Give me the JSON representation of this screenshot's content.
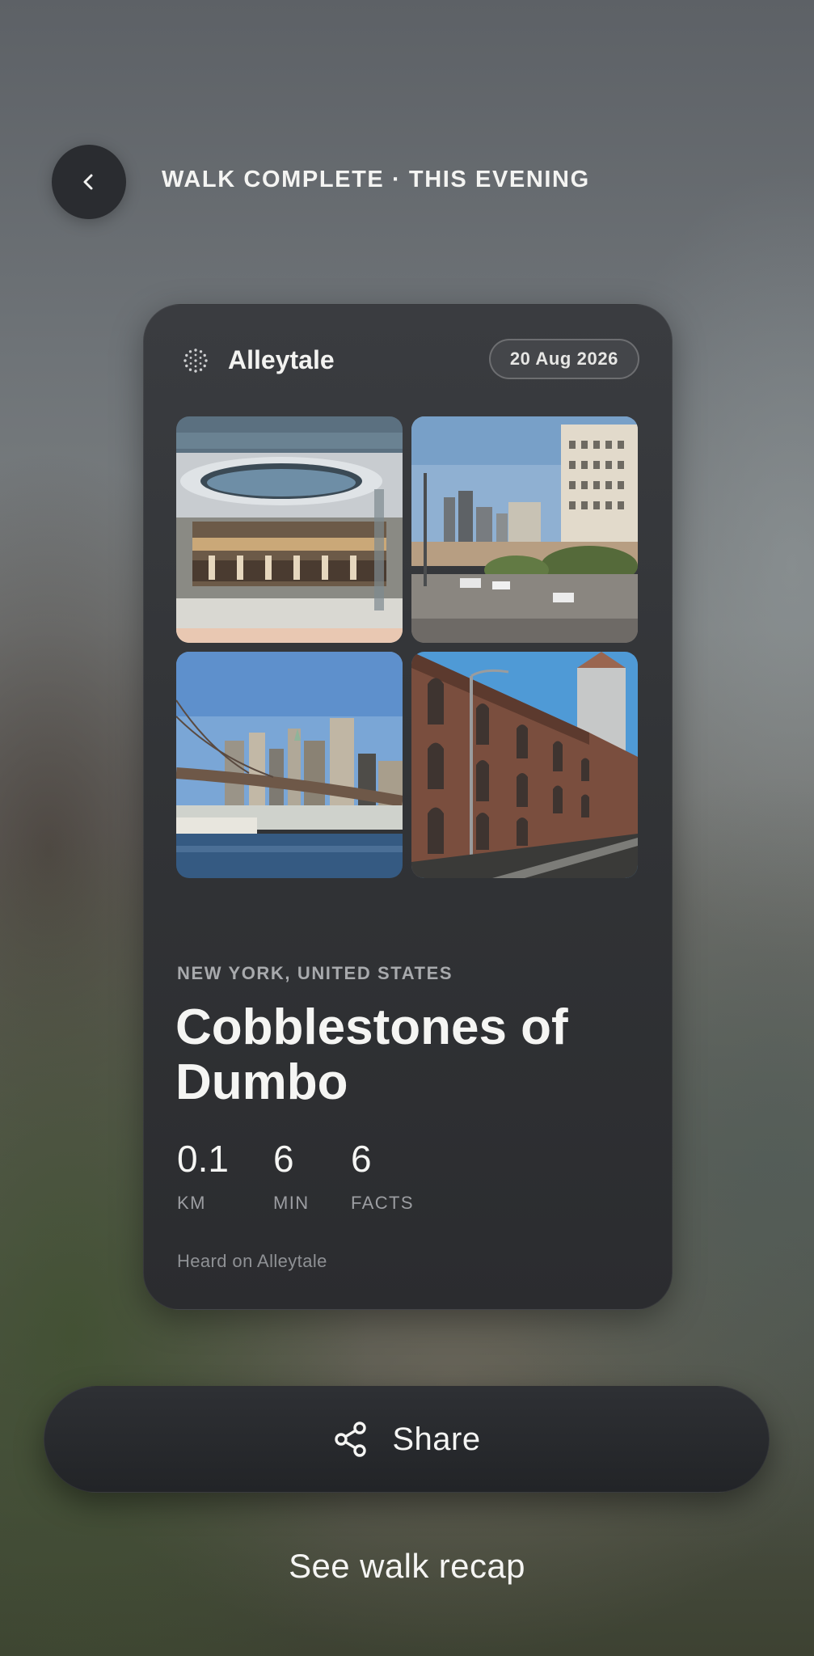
{
  "header": {
    "back_icon": "chevron-left-icon",
    "title": "WALK COMPLETE · THIS EVENING"
  },
  "card": {
    "brand": {
      "logo_icon": "dotted-circle-logo",
      "name": "Alleytale"
    },
    "date": "20 Aug 2026",
    "photos": [
      "carousel-photo",
      "street-view-photo",
      "bridge-skyline-photo",
      "brick-warehouse-photo"
    ],
    "location": "NEW YORK, UNITED STATES",
    "title": "Cobblestones of Dumbo",
    "stats": [
      {
        "value": "0.1",
        "label": "KM"
      },
      {
        "value": "6",
        "label": "MIN"
      },
      {
        "value": "6",
        "label": "FACTS"
      }
    ],
    "footer": "Heard on Alleytale"
  },
  "actions": {
    "share_icon": "share-icon",
    "share_label": "Share",
    "recap_label": "See walk recap"
  }
}
